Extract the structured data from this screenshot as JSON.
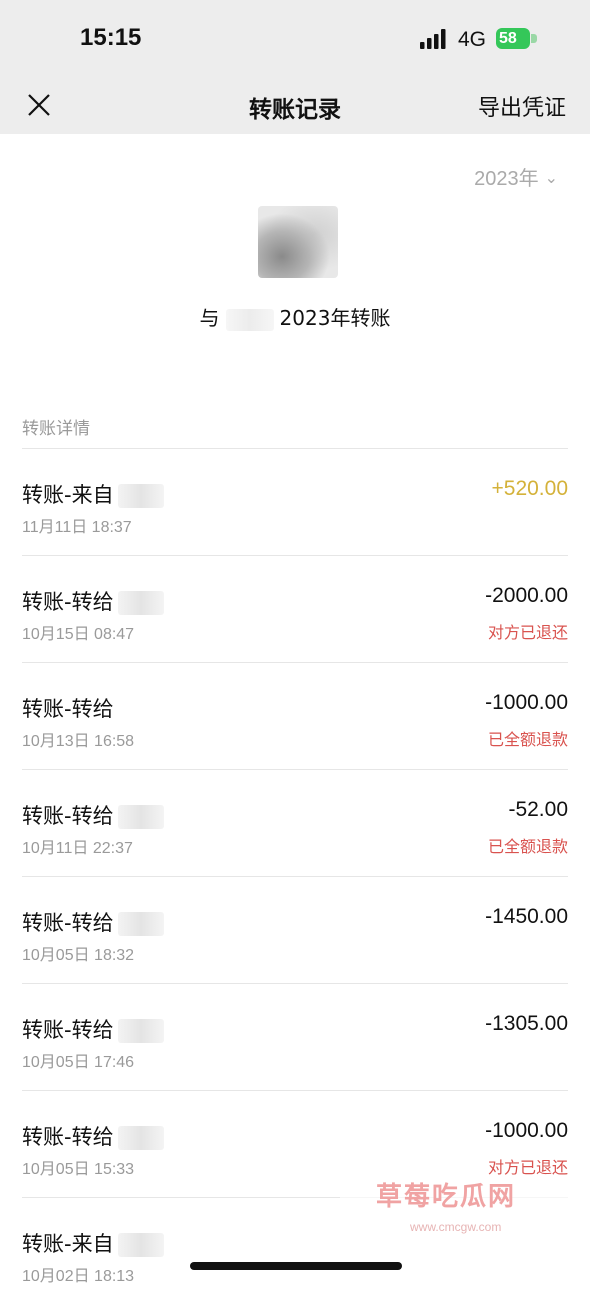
{
  "status_bar": {
    "time": "15:15",
    "network": "4G",
    "battery": "58"
  },
  "navbar": {
    "title": "转账记录",
    "export_label": "导出凭证"
  },
  "year_selector": {
    "value": "2023年"
  },
  "summary": {
    "prefix": "与",
    "suffix": "2023年转账"
  },
  "section_label": "转账详情",
  "transactions": [
    {
      "title": "转账-来自",
      "date": "11月11日 18:37",
      "amount": "+520.00",
      "status": ""
    },
    {
      "title": "转账-转给",
      "date": "10月15日 08:47",
      "amount": "-2000.00",
      "status": "对方已退还"
    },
    {
      "title": "转账-转给",
      "date": "10月13日 16:58",
      "amount": "-1000.00",
      "status": "已全额退款"
    },
    {
      "title": "转账-转给",
      "date": "10月11日 22:37",
      "amount": "-52.00",
      "status": "已全额退款"
    },
    {
      "title": "转账-转给",
      "date": "10月05日 18:32",
      "amount": "-1450.00",
      "status": ""
    },
    {
      "title": "转账-转给",
      "date": "10月05日 17:46",
      "amount": "-1305.00",
      "status": ""
    },
    {
      "title": "转账-转给",
      "date": "10月05日 15:33",
      "amount": "-1000.00",
      "status": "对方已退还"
    },
    {
      "title": "转账-来自",
      "date": "10月02日 18:13",
      "amount": "",
      "status": ""
    }
  ],
  "watermark": {
    "text": "草莓吃瓜网",
    "url": "www.cmcgw.com"
  },
  "colors": {
    "income": "#d4b23a",
    "status_red": "#d9534f",
    "bar_bg": "#ededed"
  }
}
